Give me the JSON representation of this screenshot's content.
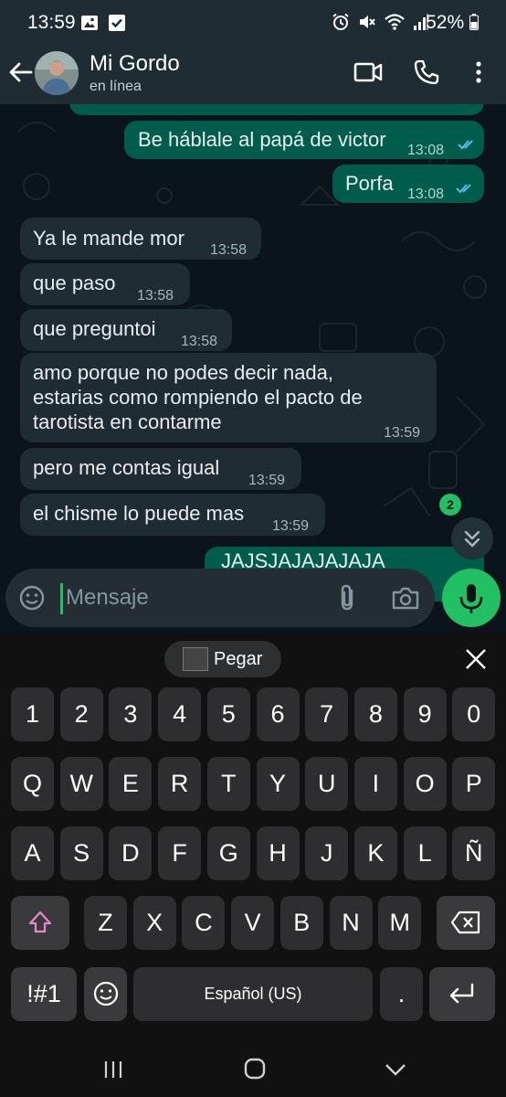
{
  "status_bar": {
    "time": "13:59",
    "battery": "52%",
    "left_icons": [
      "gallery-icon",
      "check-box-icon"
    ],
    "right_icons": [
      "alarm-icon",
      "mute-icon",
      "wifi-icon",
      "signal-icon",
      "battery-icon"
    ]
  },
  "header": {
    "contact_name": "Mi Gordo",
    "status": "en línea",
    "actions": [
      "video-call-icon",
      "phone-icon",
      "more-options-icon"
    ]
  },
  "messages": [
    {
      "direction": "out",
      "text": "Be háblale al papá de victor",
      "time": "13:08",
      "read": true
    },
    {
      "direction": "out",
      "text": "Porfa",
      "time": "13:08",
      "read": true
    },
    {
      "direction": "in",
      "text": "Ya le mande mor",
      "time": "13:58"
    },
    {
      "direction": "in",
      "text": "que paso",
      "time": "13:58"
    },
    {
      "direction": "in",
      "text": "que preguntoi",
      "time": "13:58"
    },
    {
      "direction": "in",
      "lines": [
        "amo porque no podes decir nada,",
        "estarias como rompiendo el pacto de",
        "tarotista en contarme"
      ],
      "time": "13:59"
    },
    {
      "direction": "in",
      "text": "pero me contas igual",
      "time": "13:59"
    },
    {
      "direction": "in",
      "text": "el chisme lo puede mas",
      "time": "13:59"
    },
    {
      "direction": "out",
      "text": "JAJSJAJAJAJAJA",
      "partial": true
    }
  ],
  "unread_count": "2",
  "input": {
    "placeholder": "Mensaje",
    "value": ""
  },
  "keyboard": {
    "toolbar": {
      "paste_label": "Pegar"
    },
    "rows": [
      [
        "1",
        "2",
        "3",
        "4",
        "5",
        "6",
        "7",
        "8",
        "9",
        "0"
      ],
      [
        "Q",
        "W",
        "E",
        "R",
        "T",
        "Y",
        "U",
        "I",
        "O",
        "P"
      ],
      [
        "A",
        "S",
        "D",
        "F",
        "G",
        "H",
        "J",
        "K",
        "L",
        "Ñ"
      ],
      [
        "Z",
        "X",
        "C",
        "V",
        "B",
        "N",
        "M"
      ]
    ],
    "symbols_label": "!#1",
    "space_label": "Español (US)",
    "period_label": "."
  },
  "colors": {
    "outgoing_bubble": "#005c4b",
    "incoming_bubble": "#202c33",
    "accent": "#21c063",
    "read_ticks": "#53bdeb"
  }
}
